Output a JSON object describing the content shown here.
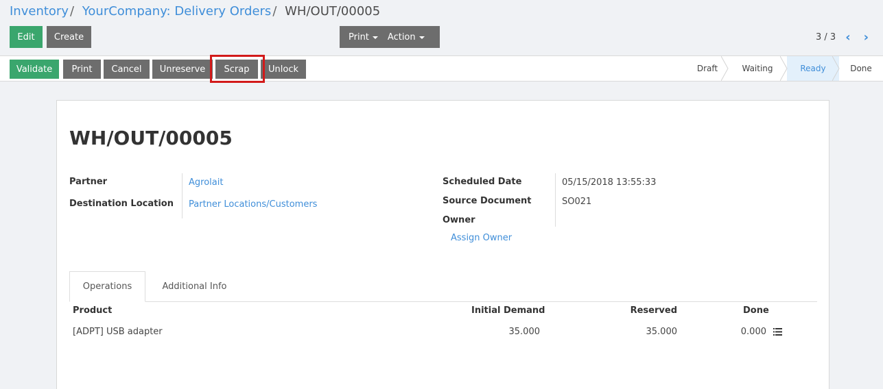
{
  "breadcrumb": {
    "items": [
      "Inventory",
      "YourCompany: Delivery Orders"
    ],
    "separator": "/",
    "current": "WH/OUT/00005"
  },
  "control_panel": {
    "edit_label": "Edit",
    "create_label": "Create",
    "print_label": "Print",
    "action_label": "Action",
    "pager_value": "3 / 3",
    "pager_prev": "‹",
    "pager_next": "›"
  },
  "statusbar": {
    "buttons": [
      "Validate",
      "Print",
      "Cancel",
      "Unreserve",
      "Scrap",
      "Unlock"
    ],
    "stages": [
      "Draft",
      "Waiting",
      "Ready",
      "Done"
    ],
    "active_stage": "Ready"
  },
  "form": {
    "title": "WH/OUT/00005",
    "partner_label": "Partner",
    "partner_value": "Agrolait",
    "destination_label": "Destination Location",
    "destination_value": "Partner Locations/Customers",
    "scheduled_date_label": "Scheduled Date",
    "scheduled_date_value": "05/15/2018 13:55:33",
    "source_document_label": "Source Document",
    "source_document_value": "SO021",
    "owner_label": "Owner",
    "assign_owner_label": "Assign Owner"
  },
  "tabs": [
    "Operations",
    "Additional Info"
  ],
  "operations": {
    "columns": [
      "Product",
      "Initial Demand",
      "Reserved",
      "Done"
    ],
    "rows": [
      {
        "product": "[ADPT] USB adapter",
        "initial_demand": "35.000",
        "reserved": "35.000",
        "done": "0.000"
      }
    ]
  },
  "colors": {
    "primary": "#3aa66d",
    "secondary": "#6d6d6d",
    "link": "#3f8ed9",
    "highlight": "#d21a1a",
    "active_stage_bg": "#e3f0fb"
  }
}
